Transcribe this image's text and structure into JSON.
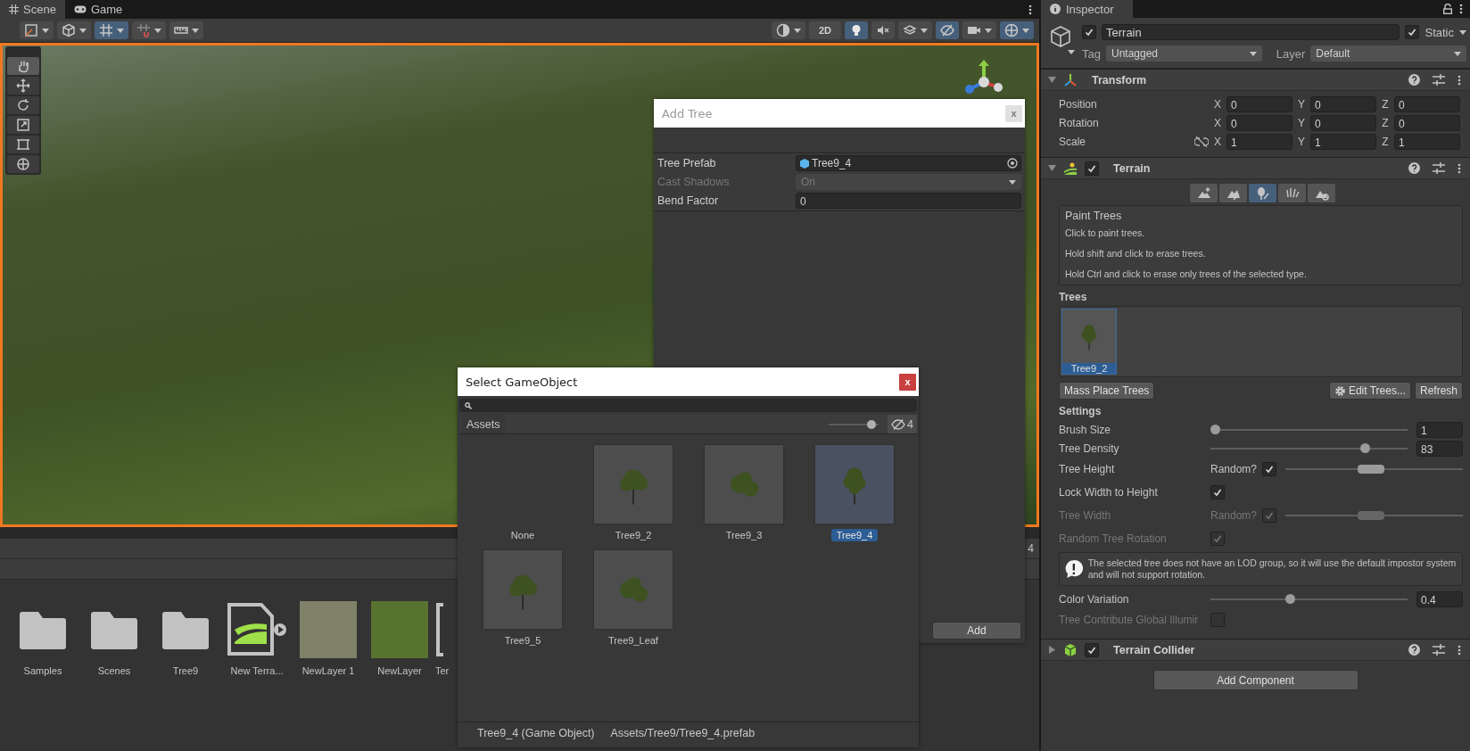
{
  "scene_tabs": [
    {
      "label": "Scene",
      "selected": true
    },
    {
      "label": "Game",
      "selected": false
    }
  ],
  "scene_toolbar": {
    "left": [
      {
        "selected": false,
        "dropdown": true
      },
      {
        "selected": false,
        "dropdown": true
      },
      {
        "selected": true,
        "dropdown": true
      },
      {
        "selected": false,
        "dropdown": true
      },
      {
        "selected": false,
        "dropdown": true
      }
    ],
    "right": [
      {
        "kind": "icon",
        "selected": false,
        "dropdown": true
      },
      {
        "kind": "text",
        "label": "2D",
        "selected": false,
        "dropdown": false
      },
      {
        "kind": "icon",
        "selected": true,
        "dropdown": false
      },
      {
        "kind": "icon",
        "selected": false,
        "dropdown": false
      },
      {
        "kind": "icon",
        "selected": false,
        "dropdown": true
      },
      {
        "kind": "icon",
        "selected": true,
        "dropdown": false
      },
      {
        "kind": "icon",
        "selected": false,
        "dropdown": true
      },
      {
        "kind": "icon",
        "selected": true,
        "dropdown": true
      }
    ]
  },
  "scene_tools": [
    {
      "selected": true
    },
    {
      "selected": false
    },
    {
      "selected": false
    },
    {
      "selected": false
    },
    {
      "selected": false
    },
    {
      "selected": false
    }
  ],
  "project": {
    "hidden_count": "4",
    "assets": [
      {
        "kind": "folder",
        "label": "Samples"
      },
      {
        "kind": "folder",
        "label": "Scenes"
      },
      {
        "kind": "folder",
        "label": "Tree9"
      },
      {
        "kind": "terrain",
        "label": "New Terra..."
      },
      {
        "kind": "texture",
        "label": "NewLayer 1",
        "color": "#7f8168"
      },
      {
        "kind": "texture",
        "label": "NewLayer",
        "color": "#587230"
      },
      {
        "kind": "file",
        "label": "Ter"
      }
    ]
  },
  "add_tree_dialog": {
    "title": "Add Tree",
    "close": "x",
    "fields": [
      {
        "kind": "object",
        "label": "Tree Prefab",
        "value": "Tree9_4",
        "disabled": false
      },
      {
        "kind": "dropdown",
        "label": "Cast Shadows",
        "value": "On",
        "disabled": true
      },
      {
        "kind": "number",
        "label": "Bend Factor",
        "value": "0",
        "disabled": false
      }
    ],
    "button": "Add"
  },
  "select_dialog": {
    "title": "Select GameObject",
    "close": "x",
    "tab": "Assets",
    "size_slider": {
      "level": 0.85
    },
    "hidden_count": "4",
    "items": [
      {
        "kind": "none",
        "label": "None",
        "selected": false
      },
      {
        "kind": "prefab",
        "label": "Tree9_2",
        "selected": false
      },
      {
        "kind": "prefab",
        "label": "Tree9_3",
        "selected": false
      },
      {
        "kind": "prefab",
        "label": "Tree9_4",
        "selected": true
      },
      {
        "kind": "prefab",
        "label": "Tree9_5",
        "selected": false
      },
      {
        "kind": "prefab",
        "label": "Tree9_Leaf",
        "selected": false
      }
    ],
    "footer": [
      "Tree9_4 (Game Object)",
      "Assets/Tree9/Tree9_4.prefab"
    ]
  },
  "inspector": {
    "tab": "Inspector",
    "object": {
      "active": true,
      "name": "Terrain",
      "static": true,
      "static_label": "Static",
      "tag_label": "Tag",
      "tag": "Untagged",
      "layer_label": "Layer",
      "layer": "Default"
    },
    "transform": {
      "title": "Transform",
      "expanded": true,
      "rows": [
        {
          "label": "Position",
          "linked": false,
          "values": [
            {
              "axis": "X",
              "value": "0"
            },
            {
              "axis": "Y",
              "value": "0"
            },
            {
              "axis": "Z",
              "value": "0"
            }
          ]
        },
        {
          "label": "Rotation",
          "linked": false,
          "values": [
            {
              "axis": "X",
              "value": "0"
            },
            {
              "axis": "Y",
              "value": "0"
            },
            {
              "axis": "Z",
              "value": "0"
            }
          ]
        },
        {
          "label": "Scale",
          "linked": true,
          "values": [
            {
              "axis": "X",
              "value": "1"
            },
            {
              "axis": "Y",
              "value": "1"
            },
            {
              "axis": "Z",
              "value": "1"
            }
          ]
        }
      ]
    },
    "terrain": {
      "title": "Terrain",
      "enabled": true,
      "expanded": true,
      "tools": [
        {
          "selected": false
        },
        {
          "selected": false
        },
        {
          "selected": true
        },
        {
          "selected": false
        },
        {
          "selected": false
        }
      ],
      "help": {
        "title": "Paint Trees",
        "lines": [
          "Click to paint trees.",
          "Hold shift and click to erase trees.",
          "Hold Ctrl and click to erase only trees of the selected type."
        ]
      },
      "trees_label": "Trees",
      "trees": [
        {
          "label": "Tree9_2",
          "selected": true
        }
      ],
      "buttons": [
        {
          "kind": "plain",
          "label": "Mass Place Trees"
        },
        {
          "kind": "gear",
          "label": "Edit Trees..."
        },
        {
          "kind": "plain",
          "label": "Refresh"
        }
      ],
      "settings_label": "Settings",
      "settings": [
        {
          "kind": "slider",
          "label": "Brush Size",
          "level": 0,
          "value": "1",
          "disabled": false
        },
        {
          "kind": "slider",
          "label": "Tree Density",
          "level": 0.8,
          "value": "83",
          "disabled": false
        },
        {
          "kind": "range",
          "label": "Tree Height",
          "random_label": "Random?",
          "random": true,
          "level": 0.48,
          "disabled": false
        },
        {
          "kind": "checkbox",
          "label": "Lock Width to Height",
          "checked": true,
          "disabled": false
        },
        {
          "kind": "range",
          "label": "Tree Width",
          "random_label": "Random?",
          "random": true,
          "level": 0.48,
          "disabled": true
        },
        {
          "kind": "checkbox",
          "label": "Random Tree Rotation",
          "checked": true,
          "disabled": true
        },
        {
          "kind": "warning",
          "text": "The selected tree does not have an LOD group, so it will use the default impostor system and will not support rotation."
        },
        {
          "kind": "slider",
          "label": "Color Variation",
          "level": 0.4,
          "value": "0.4",
          "disabled": false
        },
        {
          "kind": "checkbox",
          "label": "Tree Contribute Global Illumir",
          "checked": false,
          "disabled": true
        }
      ]
    },
    "collider": {
      "title": "Terrain Collider",
      "enabled": true,
      "expanded": false
    },
    "add_component": "Add Component"
  }
}
